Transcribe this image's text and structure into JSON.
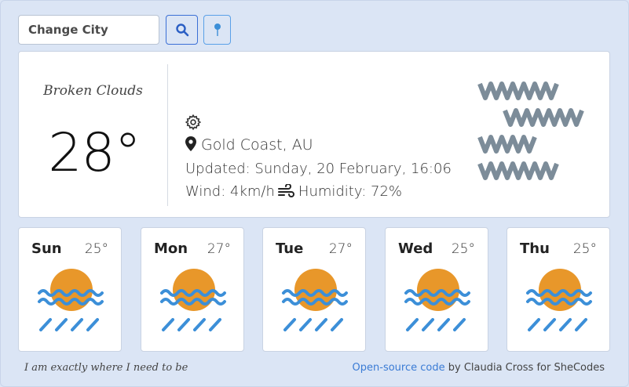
{
  "search": {
    "placeholder": "Change City",
    "search_icon": "search-icon",
    "location_icon": "map-pin-icon"
  },
  "current": {
    "description": "Broken Clouds",
    "temperature": "28°",
    "city": "Gold Coast, AU",
    "updated": "Updated: Sunday, 20 February, 16:06",
    "wind": "Wind: 4km/h",
    "humidity": "Humidity: 72%",
    "icon": "broken-clouds-icon"
  },
  "forecast": [
    {
      "day": "Sun",
      "temp": "25°",
      "icon": "sunset-haze-icon"
    },
    {
      "day": "Mon",
      "temp": "27°",
      "icon": "sunset-haze-icon"
    },
    {
      "day": "Tue",
      "temp": "27°",
      "icon": "sunset-haze-icon"
    },
    {
      "day": "Wed",
      "temp": "25°",
      "icon": "sunset-haze-icon"
    },
    {
      "day": "Thu",
      "temp": "25°",
      "icon": "sunset-haze-icon"
    }
  ],
  "footer": {
    "motto": "I am exactly where I need to be",
    "link_text": "Open-source code",
    "credit": " by Claudia Cross for SheCodes"
  },
  "colors": {
    "background": "#dbe5f5",
    "accent": "#3b6fd6",
    "sun": "#e8972a",
    "wave": "#3c8fd8",
    "cloud": "#7c8c99"
  }
}
